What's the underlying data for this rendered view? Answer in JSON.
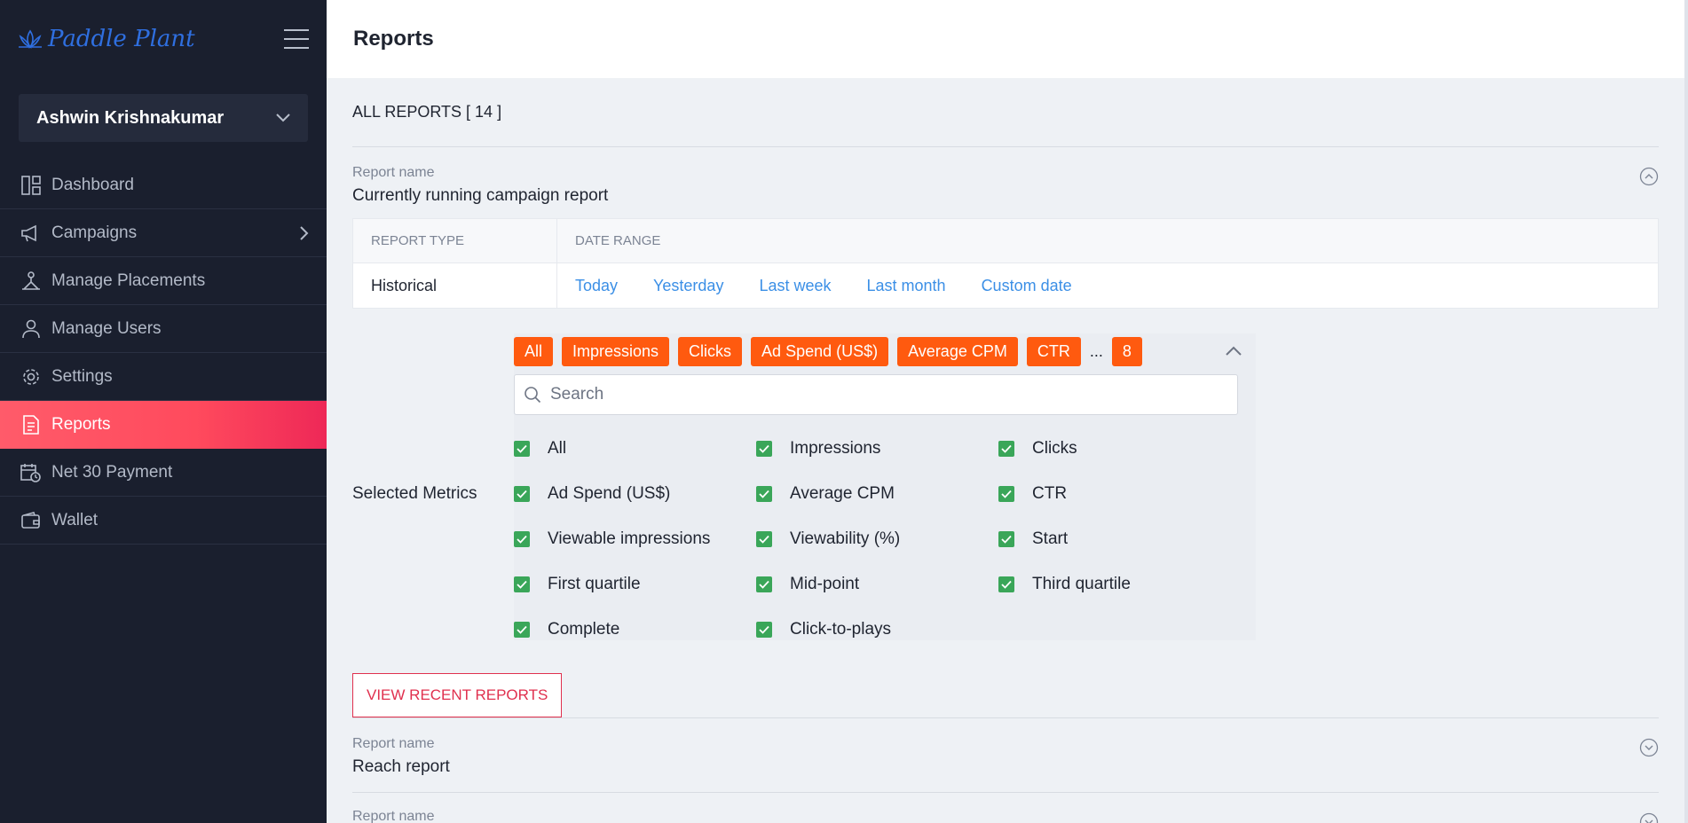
{
  "app": {
    "logo_text": "Paddle Plant",
    "accent_color": "#ff4a5d",
    "chip_color": "#ff5a0f",
    "check_color": "#3aa659",
    "link_color": "#3b8fe6"
  },
  "sidebar": {
    "user_name": "Ashwin Krishnakumar",
    "items": [
      {
        "label": "Dashboard",
        "icon": "dashboard-icon"
      },
      {
        "label": "Campaigns",
        "icon": "megaphone-icon"
      },
      {
        "label": "Manage Placements",
        "icon": "placement-icon"
      },
      {
        "label": "Manage Users",
        "icon": "user-icon"
      },
      {
        "label": "Settings",
        "icon": "gear-icon"
      },
      {
        "label": "Reports",
        "icon": "document-icon",
        "active": true
      },
      {
        "label": "Net 30 Payment",
        "icon": "calendar-clock-icon"
      },
      {
        "label": "Wallet",
        "icon": "wallet-icon"
      }
    ]
  },
  "header": {
    "title": "Reports"
  },
  "reports": {
    "all_label": "ALL REPORTS [ 14 ]",
    "report_name_label": "Report name",
    "current": {
      "name": "Currently running campaign report",
      "type_header": "REPORT TYPE",
      "date_header": "DATE RANGE",
      "type_value": "Historical",
      "date_options": [
        "Today",
        "Yesterday",
        "Last week",
        "Last month",
        "Custom date"
      ]
    },
    "metrics": {
      "label": "Selected Metrics",
      "chips": [
        "All",
        "Impressions",
        "Clicks",
        "Ad Spend (US$)",
        "Average CPM",
        "CTR"
      ],
      "ellipsis": "...",
      "more_count": "8",
      "search_placeholder": "Search",
      "options": [
        "All",
        "Impressions",
        "Clicks",
        "Ad Spend (US$)",
        "Average CPM",
        "CTR",
        "Viewable impressions",
        "Viewability (%)",
        "Start",
        "First quartile",
        "Mid-point",
        "Third quartile",
        "Complete",
        "Click-to-plays"
      ]
    },
    "view_recent_label": "VIEW RECENT REPORTS",
    "second_name": "Reach report",
    "third_label": "Report name"
  }
}
